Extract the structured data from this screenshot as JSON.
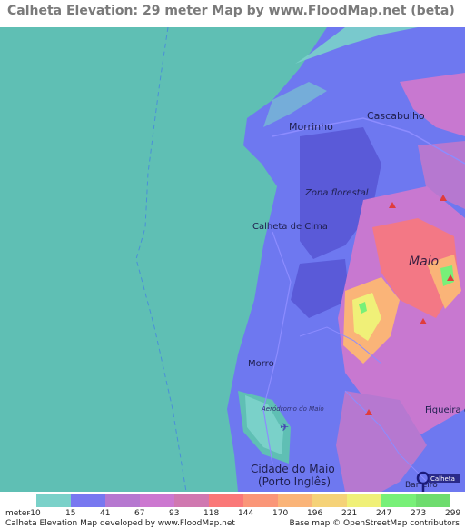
{
  "title": "Calheta Elevation: 29 meter Map by www.FloodMap.net (beta)",
  "map": {
    "places": [
      {
        "name": "Morrinho"
      },
      {
        "name": "Cascabulho"
      },
      {
        "name": "Zona florestal"
      },
      {
        "name": "Calheta de Cima"
      },
      {
        "name": "Maio"
      },
      {
        "name": "Morro"
      },
      {
        "name": "Aeródromo do Maio"
      },
      {
        "name": "Figueira da Horta"
      },
      {
        "name": "Cidade do Maio"
      },
      {
        "name": "(Porto Inglês)"
      },
      {
        "name": "Barreiro"
      }
    ],
    "marker_label": "Calheta"
  },
  "legend": {
    "unit_label": "meter",
    "ticks": [
      "-10",
      "15",
      "41",
      "67",
      "93",
      "118",
      "144",
      "170",
      "196",
      "221",
      "247",
      "273",
      "299"
    ],
    "colors": [
      "#7ad1c9",
      "#7878f0",
      "#b678d0",
      "#cc78d0",
      "#d078b0",
      "#fa7878",
      "#fa9678",
      "#fab478",
      "#f5d278",
      "#f0f078",
      "#78f078",
      "#6edc6e"
    ]
  },
  "footer": {
    "left": "Calheta Elevation Map developed by www.FloodMap.net",
    "right": "Base map © OpenStreetMap contributors"
  },
  "colors": {
    "sea": "#5fbfb4",
    "lowland": "#6e78f0",
    "reservoir": "#5a5ad8",
    "hills": "#c878d0",
    "peaks": "#f4d278"
  }
}
